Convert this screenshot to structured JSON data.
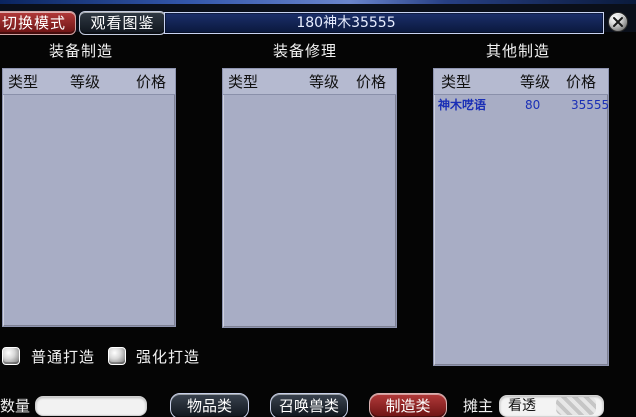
{
  "header": {
    "switch_mode_label": "切换模式",
    "view_catalog_label": "观看图鉴",
    "title": "180神木35555"
  },
  "sections": {
    "equipment_make": {
      "title": "装备制造",
      "columns": [
        "类型",
        "等级",
        "价格"
      ],
      "rows": []
    },
    "equipment_repair": {
      "title": "装备修理",
      "columns": [
        "类型",
        "等级",
        "价格"
      ],
      "rows": []
    },
    "other_make": {
      "title": "其他制造",
      "columns": [
        "类型",
        "等级",
        "价格"
      ],
      "rows": [
        {
          "type": "神木呓语",
          "level": "80",
          "price": "35555"
        }
      ]
    }
  },
  "options": {
    "normal_forge_label": "普通打造",
    "enhanced_forge_label": "强化打造"
  },
  "bottom": {
    "quantity_label": "数量",
    "quantity_value": "",
    "buttons": {
      "items": "物品类",
      "summon": "召唤兽类",
      "make": "制造类"
    },
    "stall_owner_label": "摊主",
    "view_field_value": "看透"
  },
  "icons": {
    "close": "close-icon"
  },
  "colors": {
    "panel_bg": "#a8adc5",
    "header_bg": "#b5bad0",
    "active_button": "#9e2424",
    "row_text": "#1a2fb6"
  }
}
